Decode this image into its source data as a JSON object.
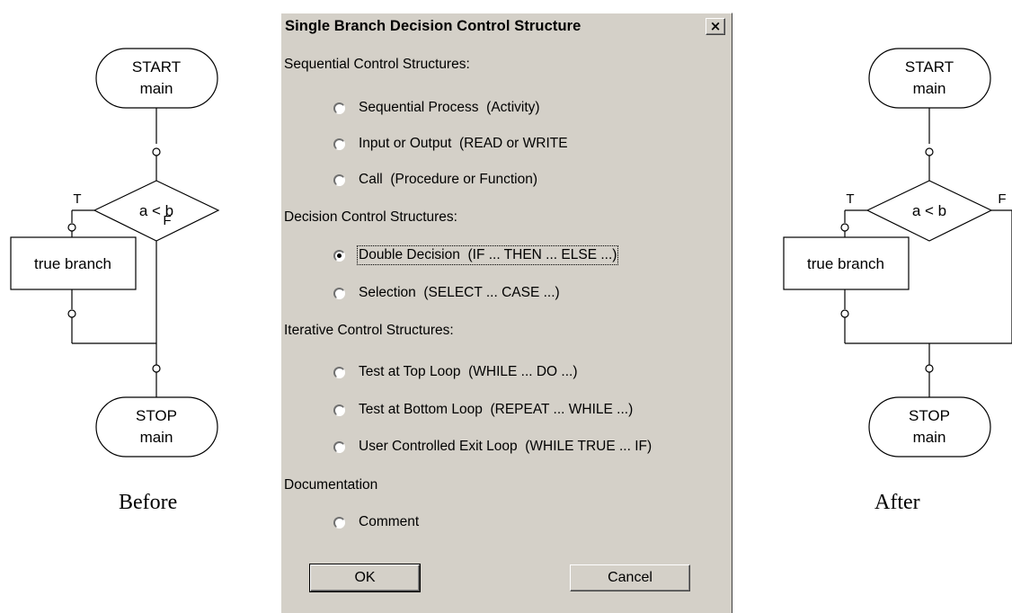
{
  "before": {
    "start_line1": "START",
    "start_line2": "main",
    "condition": "a < b",
    "true_flag": "T",
    "false_flag": "F",
    "branch_label": "true branch",
    "stop_line1": "STOP",
    "stop_line2": "main",
    "caption": "Before"
  },
  "after": {
    "start_line1": "START",
    "start_line2": "main",
    "condition": "a < b",
    "true_flag": "T",
    "false_flag": "F",
    "branch_label": "true branch",
    "stop_line1": "STOP",
    "stop_line2": "main",
    "caption": "After"
  },
  "dialog": {
    "title": "Single Branch Decision Control Structure",
    "close_glyph": "×",
    "sections": {
      "sequential": "Sequential Control Structures:",
      "decision": "Decision Control Structures:",
      "iterative": "Iterative Control Structures:",
      "documentation": "Documentation"
    },
    "options": {
      "sequential_process": "Sequential Process  (Activity)",
      "input_output": "Input or Output  (READ or WRITE",
      "call": "Call  (Procedure or Function)",
      "double_decision": "Double Decision  (IF ... THEN ... ELSE ...)",
      "selection": "Selection  (SELECT ... CASE ...)",
      "test_top": "Test at Top Loop  (WHILE ... DO ...)",
      "test_bottom": "Test at Bottom Loop  (REPEAT ... WHILE ...)",
      "user_exit": "User Controlled Exit Loop  (WHILE TRUE ... IF)",
      "comment": "Comment"
    },
    "selected_option": "double_decision",
    "ok_label": "OK",
    "cancel_label": "Cancel"
  }
}
